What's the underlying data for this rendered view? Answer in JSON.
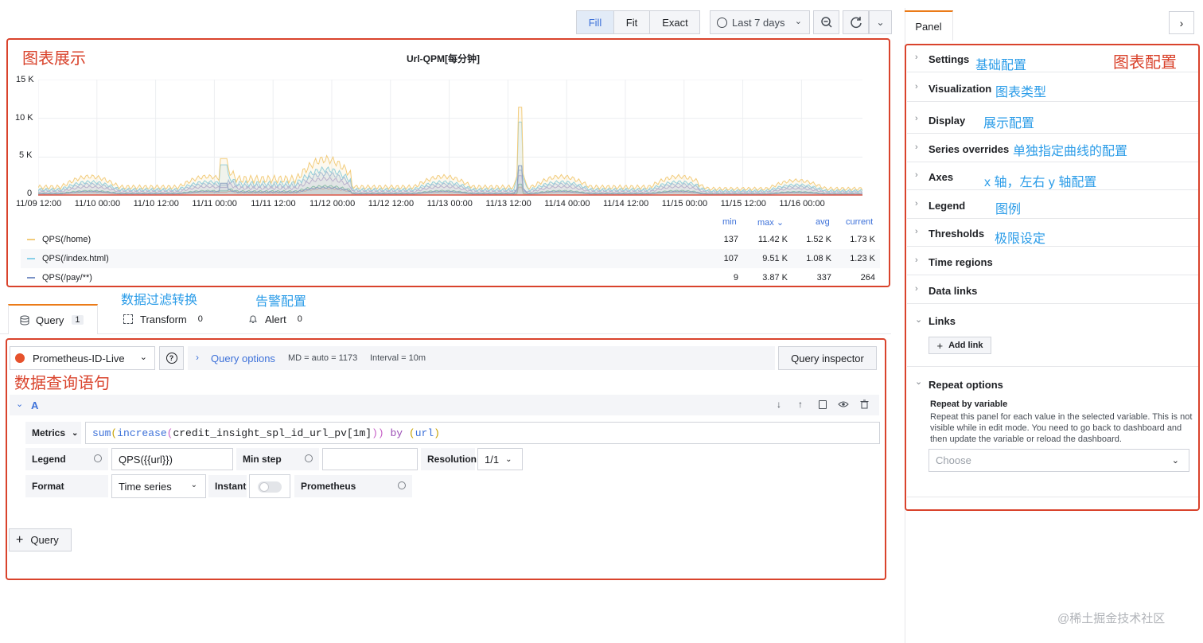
{
  "toolbar": {
    "fill": "Fill",
    "fit": "Fit",
    "exact": "Exact",
    "time_range": "Last 7 days"
  },
  "panel_tab": "Panel",
  "chart_data": {
    "type": "line",
    "title": "Url-QPM[每分钟]",
    "y_ticks": [
      "15 K",
      "10 K",
      "5 K",
      "0"
    ],
    "x_ticks": [
      "11/09 12:00",
      "11/10 00:00",
      "11/10 12:00",
      "11/11 00:00",
      "11/11 12:00",
      "11/12 00:00",
      "11/12 12:00",
      "11/13 00:00",
      "11/13 12:00",
      "11/14 00:00",
      "11/14 12:00",
      "11/15 00:00",
      "11/15 12:00",
      "11/16 00:00"
    ],
    "ylim": [
      0,
      15000
    ],
    "grid": true,
    "legend_headers": {
      "min": "min",
      "max": "max",
      "avg": "avg",
      "current": "current"
    },
    "series": [
      {
        "name": "QPS(/home)",
        "color": "#f2cc7c",
        "min": "137",
        "max": "11.42 K",
        "avg": "1.52 K",
        "current": "1.73 K",
        "peak": 11420,
        "base": 1500
      },
      {
        "name": "QPS(/index.html)",
        "color": "#8ad0e8",
        "min": "107",
        "max": "9.51 K",
        "avg": "1.08 K",
        "current": "1.23 K",
        "peak": 9510,
        "base": 1080
      },
      {
        "name": "QPS(/pay/**)",
        "color": "#7b92c6",
        "min": "9",
        "max": "3.87 K",
        "avg": "337",
        "current": "264",
        "peak": 3870,
        "base": 337
      }
    ]
  },
  "query_tabs": [
    {
      "label": "Query",
      "count": "1"
    },
    {
      "label": "Transform",
      "count": "0"
    },
    {
      "label": "Alert",
      "count": "0"
    }
  ],
  "query": {
    "datasource": "Prometheus-ID-Live",
    "options_label": "Query options",
    "md": "MD = auto = 1173",
    "interval": "Interval = 10m",
    "inspector": "Query inspector",
    "ref_id": "A",
    "metrics_label": "Metrics",
    "expr_parts": [
      "sum",
      "(",
      "increase",
      "(",
      "credit_insight_spl_id_url_pv[1m]",
      "))",
      " by ",
      "(",
      "url",
      ")"
    ],
    "legend_label": "Legend",
    "legend_value": "QPS({{url}})",
    "min_step_label": "Min step",
    "resolution_label": "Resolution",
    "resolution_value": "1/1",
    "format_label": "Format",
    "format_value": "Time series",
    "instant_label": "Instant",
    "prometheus_label": "Prometheus",
    "add_query": "Query"
  },
  "sidebar": {
    "sections": [
      "Settings",
      "Visualization",
      "Display",
      "Series overrides",
      "Axes",
      "Legend",
      "Thresholds",
      "Time regions",
      "Data links",
      "Links"
    ],
    "add_link": "Add link",
    "repeat_options": "Repeat options",
    "repeat_by_variable": "Repeat by variable",
    "repeat_desc": "Repeat this panel for each value in the selected variable. This is not visible while in edit mode. You need to go back to dashboard and then update the variable or reload the dashboard.",
    "choose_placeholder": "Choose"
  },
  "annotations": {
    "chart_display": "图表展示",
    "chart_config": "图表配置",
    "basic_config": "基础配置",
    "chart_type": "图表类型",
    "display_config": "展示配置",
    "series_overrides": "单独指定曲线的配置",
    "axes_config": "x 轴，左右 y 轴配置",
    "legend": "图例",
    "thresholds": "极限设定",
    "data_filter": "数据过滤转换",
    "alert_config": "告警配置",
    "query_statement": "数据查询语句"
  },
  "watermark": "@稀土掘金技术社区"
}
